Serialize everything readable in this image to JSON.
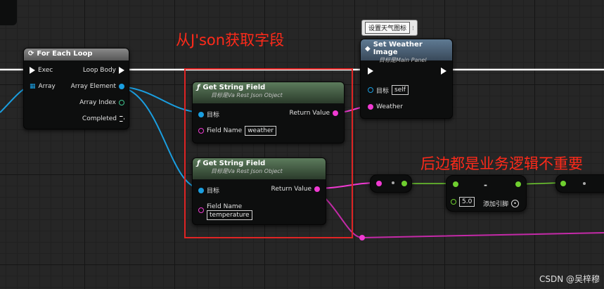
{
  "nodes": {
    "for_each": {
      "title": "For Each Loop",
      "exec_in": "Exec",
      "loop_body": "Loop Body",
      "array_in": "Array",
      "array_element": "Array Element",
      "array_index": "Array Index",
      "completed": "Completed"
    },
    "get_string_1": {
      "title": "Get String Field",
      "subtitle": "目标是Va Rest Json Object",
      "target": "目标",
      "return_value": "Return Value",
      "field_name_label": "Field Name",
      "field_name_value": "weather"
    },
    "get_string_2": {
      "title": "Get String Field",
      "subtitle": "目标是Va Rest Json Object",
      "target": "目标",
      "return_value": "Return Value",
      "field_name_label": "Field Name",
      "field_name_value": "temperature"
    },
    "set_weather": {
      "title": "Set Weather Image",
      "subtitle": "目标是Main Panel",
      "target": "目标",
      "target_value": "self",
      "weather": "Weather"
    },
    "math_node": {
      "value": "5.0",
      "minus": "-",
      "add_pin": "添加引脚"
    }
  },
  "tooltip": {
    "text": "设置天气图标"
  },
  "annotations": {
    "top": "从J'son获取字段",
    "right": "后边都是业务逻辑不重要"
  },
  "watermark": "CSDN @吴梓穆",
  "colors": {
    "annotation": "#ff2a1a",
    "string_pin": "#f03ad2",
    "object_pin": "#1a9ee0",
    "float_pin": "#6fcf2f"
  }
}
